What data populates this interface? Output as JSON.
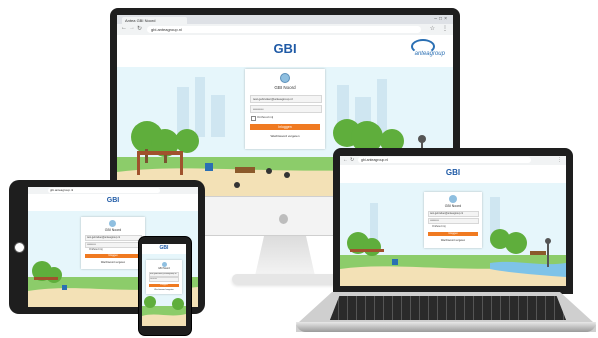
{
  "brand": {
    "accent": "#f07a21",
    "title_color": "#1f5aa6",
    "sky": "#dff3fb",
    "grass": "#8ccc6a",
    "logo_color": "#2a6fb3"
  },
  "browser": {
    "tab_label": "Antea GBI Noord",
    "address": "gbi.anteagroup.nl",
    "icons": [
      "back-icon",
      "forward-icon",
      "reload-icon",
      "lock-icon",
      "star-icon",
      "menu-icon"
    ]
  },
  "app": {
    "title": "GBI",
    "logo_word": "anteagroup",
    "login": {
      "heading": "GBI Noord",
      "username_value": "test.gebruiker@anteagroup.nl",
      "password_value": "••••••••••",
      "remember_label": "Onthoud mij",
      "submit_label": "Inloggen",
      "forgot_label": "Wachtwoord vergeten"
    }
  }
}
